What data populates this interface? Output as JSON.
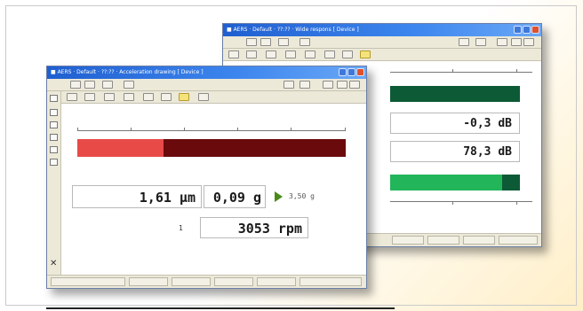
{
  "colors": {
    "title_blue": "#2a6fe0",
    "red_light": "#e84a48",
    "red_dark": "#6a0a0c",
    "green_dark": "#0d5a36",
    "green_light": "#22b55a",
    "play_green": "#4a8a1a"
  },
  "back_window": {
    "title": "■ AERS · Default · ??:?? · Wide respons [ Device ]",
    "readouts": {
      "level_1": "-0,3 dB",
      "level_2": "78,3 dB"
    },
    "bars": {
      "top_level": 1.0,
      "bottom_level": 0.86
    }
  },
  "front_window": {
    "title": "■ AERS · Default · ??:?? · Acceleration drawing [ Device ]",
    "bar": {
      "level": 0.32
    },
    "readouts": {
      "displacement": "1,61 µm",
      "acceleration": "0,09 g",
      "limit": "3,50 g",
      "channel": "1",
      "speed": "3053 rpm"
    },
    "icons": {
      "close": "close-icon",
      "play": "play-icon"
    }
  }
}
